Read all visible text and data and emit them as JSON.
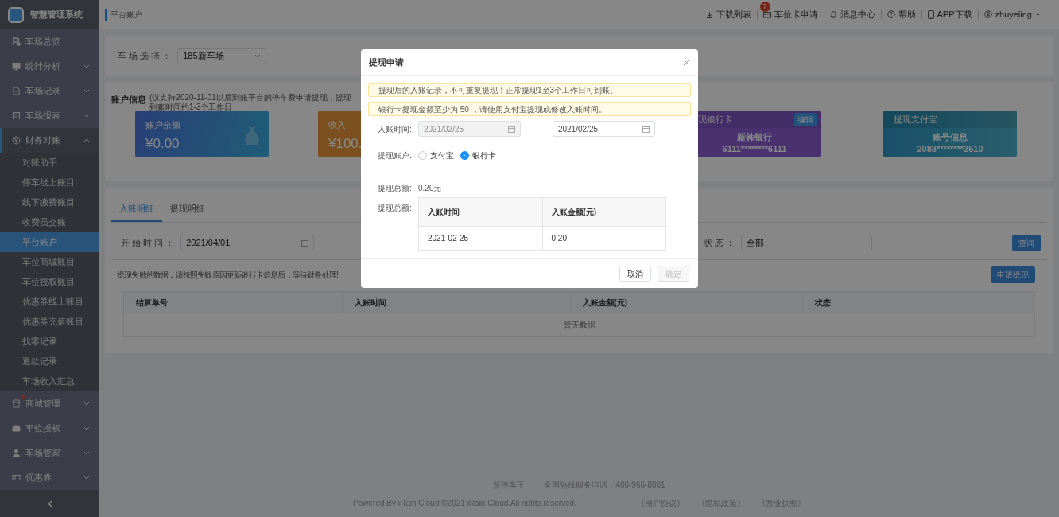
{
  "sidebar": {
    "logo": "智慧管理系统",
    "items": [
      {
        "label": "车场总览",
        "selected": false
      },
      {
        "label": "统计分析",
        "selected": false,
        "expanded": false
      },
      {
        "label": "车场记录",
        "selected": false,
        "expanded": false
      },
      {
        "label": "车场报表",
        "selected": false,
        "expanded": false
      },
      {
        "label": "财务对账",
        "selected": true,
        "expanded": true,
        "children": [
          {
            "label": "对账助手",
            "selected": false
          },
          {
            "label": "停车线上账目",
            "selected": false
          },
          {
            "label": "线下缴费账目",
            "selected": false
          },
          {
            "label": "收费员交账",
            "selected": false
          },
          {
            "label": "平台账户",
            "selected": true
          },
          {
            "label": "车位商城账目",
            "selected": false
          },
          {
            "label": "车位授权账目",
            "selected": false
          },
          {
            "label": "优惠券线上账目",
            "selected": false
          },
          {
            "label": "优惠券充值账目",
            "selected": false
          },
          {
            "label": "找零记录",
            "selected": false
          },
          {
            "label": "退款记录",
            "selected": false
          },
          {
            "label": "车场收入汇总",
            "selected": false
          }
        ]
      },
      {
        "label": "商城管理",
        "selected": false,
        "expanded": false,
        "notification": true
      },
      {
        "label": "车位授权",
        "selected": false,
        "expanded": false
      },
      {
        "label": "车场管家",
        "selected": false,
        "expanded": false
      },
      {
        "label": "优惠券",
        "selected": false,
        "expanded": false
      }
    ]
  },
  "topbar": {
    "breadcrumb": "平台账户",
    "actions": [
      {
        "label": "下载列表"
      },
      {
        "label": "车位卡申请",
        "badge": "7"
      },
      {
        "label": "消息中心"
      },
      {
        "label": "帮助"
      },
      {
        "label": "APP下载"
      }
    ],
    "user": "zhuyeling"
  },
  "parking_filter": {
    "label": "车 场 选 择 ：",
    "value": "185新车场"
  },
  "account": {
    "title": "账户信息",
    "note": "(仅支持2020-11-01以后到账平台的停车费申请提现，提现到账时间约1-3个工作日",
    "cards": [
      {
        "kind": "balance",
        "label": "账户余额",
        "amount": "¥0.00"
      },
      {
        "kind": "income",
        "label": "收入",
        "amount": "¥100."
      },
      {
        "kind": "bank",
        "title": "现银行卡",
        "action": "编辑",
        "name": "新韩银行",
        "number": "6111********6111"
      },
      {
        "kind": "alipay",
        "title": "提现支付宝",
        "name": "账号信息",
        "number": "2088********2510"
      }
    ]
  },
  "records": {
    "tabs": [
      {
        "label": "入账明细",
        "selected": true
      },
      {
        "label": "提现明细",
        "selected": false
      }
    ],
    "start": {
      "label": "开 始 时 间 ：",
      "value": "2021/04/01"
    },
    "status": {
      "label": "状 态 ：",
      "value": "全部"
    },
    "query": "查询",
    "notice": "提现失败的数据，请按照失败原因更新银行卡信息后，等待财务处理!",
    "apply": "申请提现",
    "table": {
      "columns": [
        "结算单号",
        "入账时间",
        "入账金额(元)",
        "状态"
      ],
      "empty": "暂无数据"
    }
  },
  "footer": {
    "brand": "慧停车王",
    "hotline": "全国热线服务电话：400-966-8001",
    "copyright": "Powered By iRain Cloud ©2021 iRain Cloud.All rights reserved.",
    "links": [
      "《用户协议》",
      "《隐私政策》",
      "《营业执照》"
    ]
  },
  "dialog": {
    "title": "提现申请",
    "alerts": [
      "提现后的入账记录，不可重复提现！正常提现1至3个工作日可到账。",
      "银行卡提现金额至少为 50 ，请使用支付宝提现或修改入账时间。"
    ],
    "date_label": "入账时间:",
    "date_from": {
      "value": "2021/02/25",
      "disabled": true
    },
    "separator": "——",
    "date_to": {
      "value": "2021/02/25",
      "disabled": false
    },
    "account_label": "提现账户:",
    "accounts": [
      {
        "label": "支付宝",
        "selected": false
      },
      {
        "label": "银行卡",
        "selected": true
      }
    ],
    "total_label": "提现总额:",
    "total": "0.20元",
    "detail_label": "提现总额:",
    "table": {
      "columns": [
        "入账时间",
        "入账金额(元)"
      ],
      "rows": [
        [
          "2021-02-25",
          "0.20"
        ]
      ]
    },
    "buttons": [
      {
        "label": "取消",
        "disabled": false
      },
      {
        "label": "确定",
        "disabled": true
      }
    ]
  }
}
